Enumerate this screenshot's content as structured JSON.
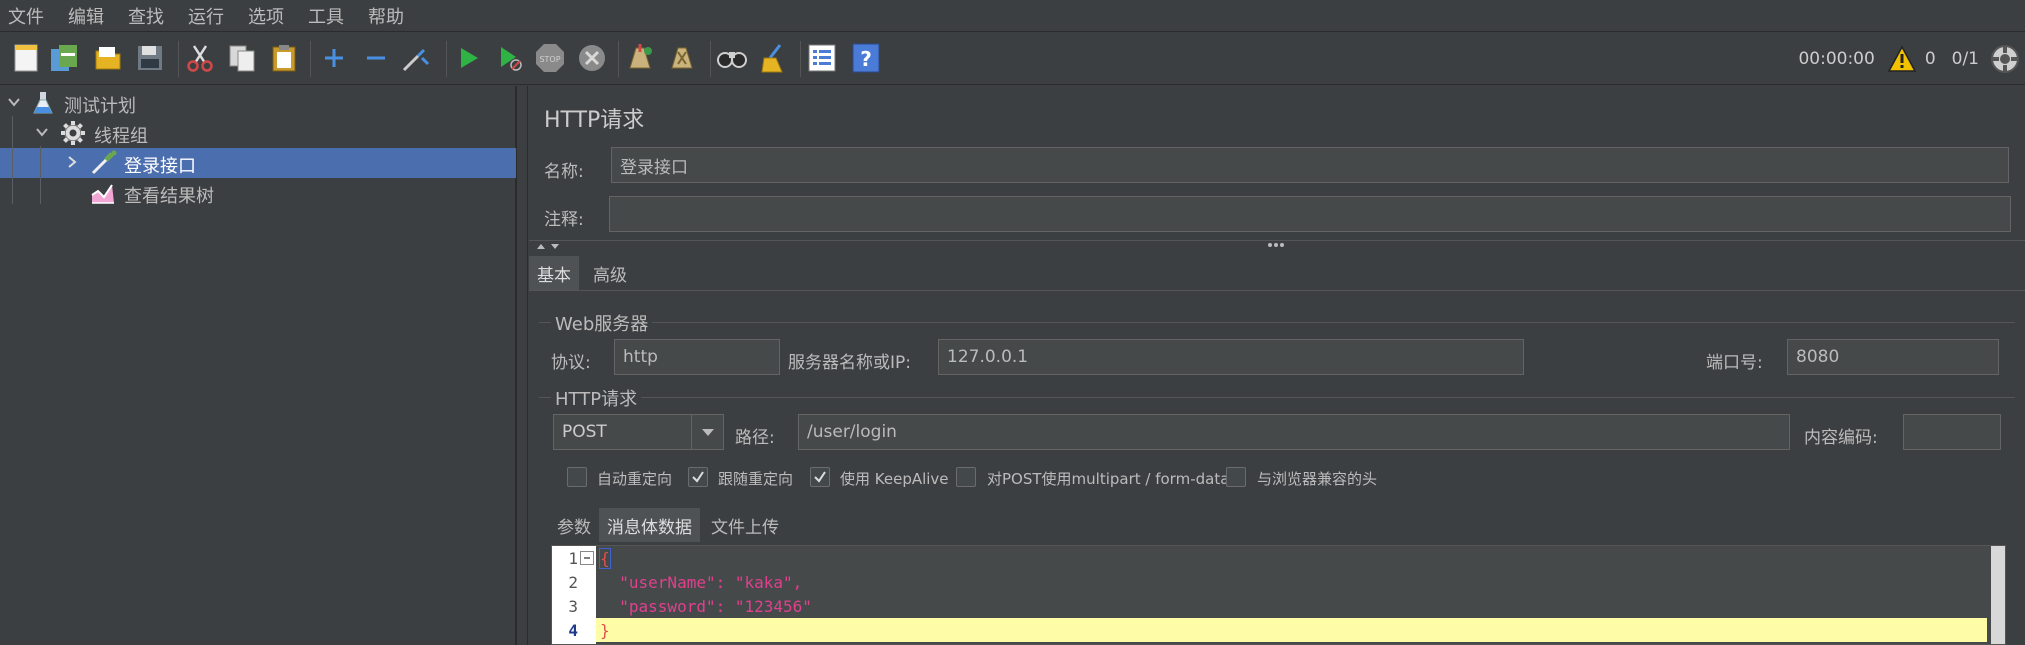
{
  "menubar": {
    "items": [
      "文件",
      "编辑",
      "查找",
      "运行",
      "选项",
      "工具",
      "帮助"
    ]
  },
  "toolbar": {
    "buttons": [
      {
        "name": "new-icon",
        "color": "#f0f0f0"
      },
      {
        "name": "templates-icon",
        "color": "#6aa84f"
      },
      {
        "name": "open-icon",
        "color": "#e6b422"
      },
      {
        "name": "save-icon",
        "color": "#9aa4ad"
      },
      {
        "name": "cut-icon",
        "color": "#d04848"
      },
      {
        "name": "copy-icon",
        "color": "#c8c8c8"
      },
      {
        "name": "paste-icon",
        "color": "#e6b422"
      },
      {
        "name": "expand-icon",
        "color": "#4a90e2"
      },
      {
        "name": "collapse-icon",
        "color": "#4a90e2"
      },
      {
        "name": "toggle-icon",
        "color": "#9aa4ad"
      },
      {
        "name": "start-icon",
        "color": "#2fb344"
      },
      {
        "name": "start-no-pause-icon",
        "color": "#2fb344"
      },
      {
        "name": "stop-icon",
        "color": "#8a8a8a"
      },
      {
        "name": "shutdown-icon",
        "color": "#8a8a8a"
      },
      {
        "name": "clear-icon",
        "color": "#c9b27c"
      },
      {
        "name": "clear-all-icon",
        "color": "#c9b27c"
      },
      {
        "name": "search-icon",
        "color": "#cfcfcf"
      },
      {
        "name": "reset-search-icon",
        "color": "#e6b422"
      },
      {
        "name": "function-helper-icon",
        "color": "#ffffff"
      },
      {
        "name": "help-icon",
        "color": "#4a7bd6"
      }
    ],
    "timer": "00:00:00",
    "warning_count": "0",
    "threads": "0/1"
  },
  "tree": {
    "nodes": [
      {
        "label": "测试计划",
        "icon": "flask-icon"
      },
      {
        "label": "线程组",
        "icon": "gear-icon"
      },
      {
        "label": "登录接口",
        "icon": "pipette-icon"
      },
      {
        "label": "查看结果树",
        "icon": "chart-icon"
      }
    ]
  },
  "panel": {
    "title": "HTTP请求",
    "name_label": "名称:",
    "name_value": "登录接口",
    "comment_label": "注释:",
    "comment_value": "",
    "tabs": [
      "基本",
      "高级"
    ],
    "web_server": {
      "title": "Web服务器",
      "protocol_label": "协议:",
      "protocol_value": "http",
      "server_label": "服务器名称或IP:",
      "server_value": "127.0.0.1",
      "port_label": "端口号:",
      "port_value": "8080"
    },
    "http_request": {
      "title": "HTTP请求",
      "method": "POST",
      "path_label": "路径:",
      "path_value": "/user/login",
      "encoding_label": "内容编码:",
      "encoding_value": ""
    },
    "checkboxes": [
      {
        "label": "自动重定向",
        "checked": false
      },
      {
        "label": "跟随重定向",
        "checked": true
      },
      {
        "label": "使用 KeepAlive",
        "checked": true
      },
      {
        "label": "对POST使用multipart / form-data",
        "checked": false
      },
      {
        "label": "与浏览器兼容的头",
        "checked": false
      }
    ],
    "body_tabs": [
      "参数",
      "消息体数据",
      "文件上传"
    ],
    "editor": {
      "line_numbers": [
        "1",
        "2",
        "3",
        "4"
      ],
      "lines": [
        "{",
        "  \"userName\": \"kaka\",",
        "  \"password\": \"123456\"",
        "}"
      ]
    }
  }
}
